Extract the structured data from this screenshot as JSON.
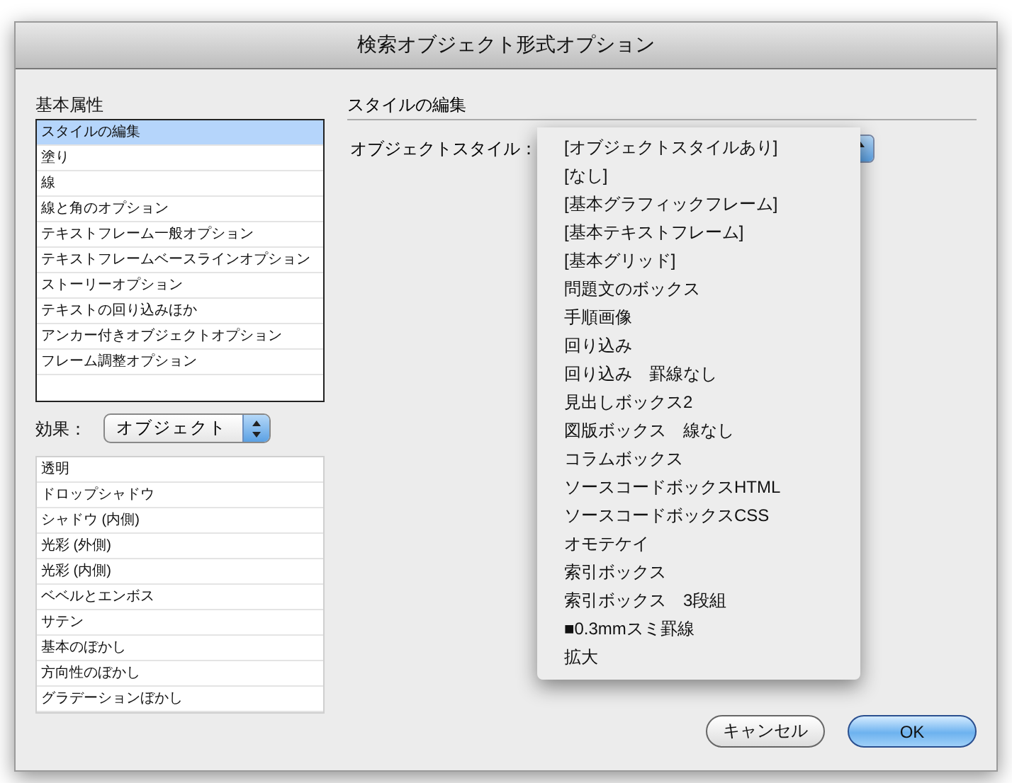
{
  "window": {
    "title": "検索オブジェクト形式オプション"
  },
  "basic_attributes": {
    "label": "基本属性",
    "items": [
      {
        "label": "スタイルの編集",
        "selected": true
      },
      {
        "label": "塗り",
        "selected": false
      },
      {
        "label": "線",
        "selected": false
      },
      {
        "label": "線と角のオプション",
        "selected": false
      },
      {
        "label": "テキストフレーム一般オプション",
        "selected": false
      },
      {
        "label": "テキストフレームベースラインオプション",
        "selected": false
      },
      {
        "label": "ストーリーオプション",
        "selected": false
      },
      {
        "label": "テキストの回り込みほか",
        "selected": false
      },
      {
        "label": "アンカー付きオブジェクトオプション",
        "selected": false
      },
      {
        "label": "フレーム調整オプション",
        "selected": false
      }
    ]
  },
  "effects": {
    "label": "効果：",
    "select": {
      "value": "オブジェクト"
    },
    "items": [
      {
        "label": "透明"
      },
      {
        "label": "ドロップシャドウ"
      },
      {
        "label": "シャドウ (内側)"
      },
      {
        "label": "光彩 (外側)"
      },
      {
        "label": "光彩 (内側)"
      },
      {
        "label": "ベベルとエンボス"
      },
      {
        "label": "サテン"
      },
      {
        "label": "基本のぼかし"
      },
      {
        "label": "方向性のぼかし"
      },
      {
        "label": "グラデーションぼかし"
      }
    ]
  },
  "style_edit": {
    "heading": "スタイルの編集",
    "object_style_label": "オブジェクトスタイル：",
    "menu": [
      {
        "label": "[オブジェクトスタイルあり]"
      },
      {
        "label": "[なし]"
      },
      {
        "label": "[基本グラフィックフレーム]"
      },
      {
        "label": "[基本テキストフレーム]"
      },
      {
        "label": "[基本グリッド]"
      },
      {
        "label": "問題文のボックス"
      },
      {
        "label": "手順画像"
      },
      {
        "label": "回り込み"
      },
      {
        "label": "回り込み　罫線なし"
      },
      {
        "label": "見出しボックス2"
      },
      {
        "label": "図版ボックス　線なし"
      },
      {
        "label": "コラムボックス"
      },
      {
        "label": "ソースコードボックスHTML"
      },
      {
        "label": "ソースコードボックスCSS"
      },
      {
        "label": "オモテケイ"
      },
      {
        "label": "索引ボックス"
      },
      {
        "label": "索引ボックス　3段組"
      },
      {
        "label": "■0.3mmスミ罫線"
      },
      {
        "label": "拡大"
      }
    ]
  },
  "buttons": [
    {
      "label": "キャンセル",
      "kind": "normal"
    },
    {
      "label": "OK",
      "kind": "default"
    }
  ]
}
